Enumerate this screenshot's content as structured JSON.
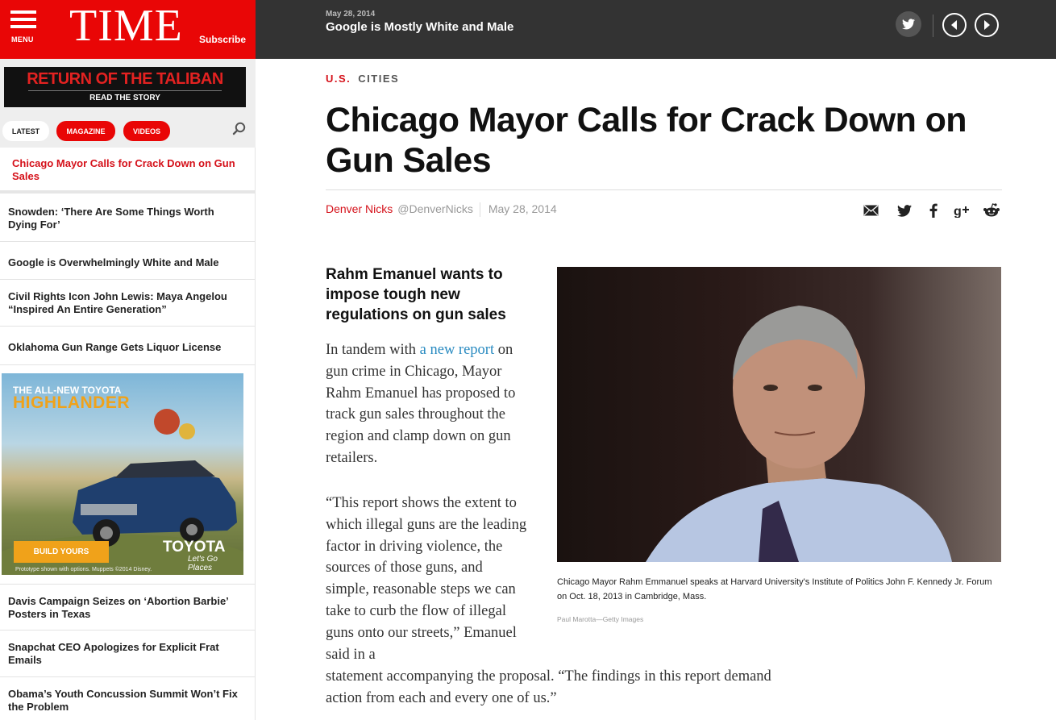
{
  "brand": {
    "menu_label": "MENU",
    "logo": "TIME",
    "subscribe_label": "Subscribe"
  },
  "topbar": {
    "date": "May 28, 2014",
    "title": "Google is Mostly White and Male"
  },
  "sidebar": {
    "promo": {
      "title": "RETURN OF THE TALIBAN",
      "cta": "READ THE STORY"
    },
    "tabs": [
      "LATEST",
      "MAGAZINE",
      "VIDEOS"
    ],
    "items": [
      "Chicago Mayor Calls for Crack Down on Gun Sales",
      "Snowden: ‘There Are Some Things Worth Dying For’",
      "Google is Overwhelmingly White and Male",
      "Civil Rights Icon John Lewis: Maya Angelou “Inspired An Entire Generation”",
      "Oklahoma Gun Range Gets Liquor License",
      "Davis Campaign Seizes on ‘Abortion Barbie’ Posters in Texas",
      "Snapchat CEO Apologizes for Explicit Frat Emails",
      "Obama’s Youth Concussion Summit Won’t Fix the Problem"
    ],
    "ad": {
      "headline1": "THE ALL-NEW TOYOTA",
      "headline2": "HIGHLANDER",
      "cta": "BUILD YOURS",
      "brand": "TOYOTA",
      "slogan": "Let's Go Places",
      "fine_print": "Prototype shown with options. Muppets ©2014 Disney."
    }
  },
  "article": {
    "section": "U.S.",
    "subsection": "CITIES",
    "headline": "Chicago Mayor Calls for Crack Down on Gun Sales",
    "author": "Denver Nicks",
    "handle": "@DenverNicks",
    "date": "May 28, 2014",
    "dek": "Rahm Emanuel wants to impose tough new regulations on gun sales",
    "p1_before": "In tandem with ",
    "p1_link": "a new report",
    "p1_after": " on gun crime in Chicago, Mayor Rahm Emanuel has proposed to track gun sales throughout the region and clamp down on gun retailers.",
    "p2": "“This report shows the extent to which illegal guns are the leading factor in driving violence, the sources of those guns, and simple, reasonable steps we can take to curb the flow of illegal guns onto our streets,” Emanuel said in a",
    "p3": "statement accompanying the proposal. “The findings in this report demand action from each and every one of us.”",
    "caption": "Chicago Mayor Rahm Emmanuel speaks at Harvard University's Institute of Politics John F. Kennedy Jr. Forum on Oct. 18, 2013 in Cambridge, Mass.",
    "credit": "Paul Marotta—Getty Images"
  },
  "colors": {
    "brand_red": "#e90606",
    "accent_red": "#d5111a",
    "topbar": "#333333",
    "link_blue": "#2a8bc1"
  },
  "icons": [
    "menu-icon",
    "twitter-icon",
    "prev-arrow-icon",
    "next-arrow-icon",
    "search-icon",
    "email-icon",
    "facebook-icon",
    "google-plus-icon",
    "reddit-icon"
  ]
}
